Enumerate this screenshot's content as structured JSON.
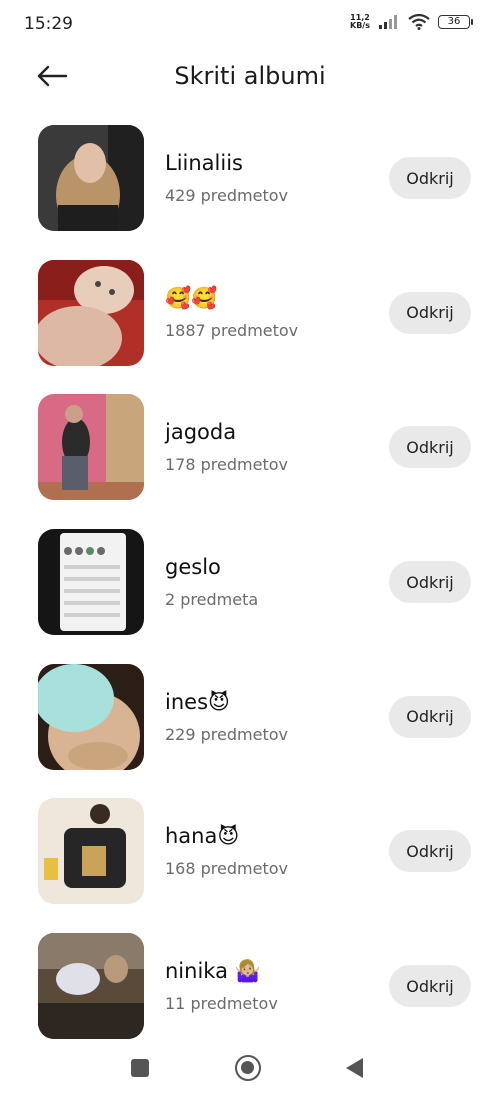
{
  "status_bar": {
    "time": "15:29",
    "net_speed_value": "11,2",
    "net_speed_unit": "KB/s",
    "battery": "36"
  },
  "header": {
    "title": "Skriti albumi"
  },
  "albums": [
    {
      "name": "Liinaliis",
      "count": "429 predmetov",
      "action": "Odkrij"
    },
    {
      "name": "🥰🥰",
      "count": "1887 predmetov",
      "action": "Odkrij"
    },
    {
      "name": "jagoda",
      "count": "178 predmetov",
      "action": "Odkrij"
    },
    {
      "name": "geslo",
      "count": "2 predmeta",
      "action": "Odkrij"
    },
    {
      "name": "ines😈",
      "count": "229 predmetov",
      "action": "Odkrij"
    },
    {
      "name": "hana😈",
      "count": "168 predmetov",
      "action": "Odkrij"
    },
    {
      "name": "ninika 🤷🏼‍♀️",
      "count": "11 predmetov",
      "action": "Odkrij"
    }
  ],
  "icons": {
    "back": "arrow-left-icon",
    "signal": "signal-icon",
    "wifi": "wifi-icon",
    "battery": "battery-icon",
    "nav_recents": "square-icon",
    "nav_home": "circle-icon",
    "nav_back": "triangle-back-icon"
  },
  "colors": {
    "button_bg": "#e9e9e9",
    "secondary_text": "#6b6b6b"
  }
}
